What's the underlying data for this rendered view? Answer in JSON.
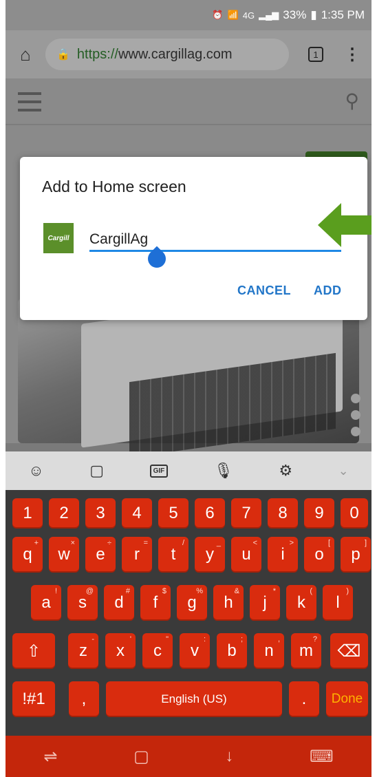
{
  "status_bar": {
    "time": "1:35 PM",
    "battery": "33%",
    "network": "4G",
    "icons": [
      "alarm-icon",
      "wifi-icon",
      "signal-icon",
      "battery-icon"
    ]
  },
  "browser": {
    "url_scheme": "https://",
    "url_host": "www.cargillag.com",
    "tab_count": "1",
    "home_icon": "home-icon",
    "menu_icon": "more-vert-icon"
  },
  "dialog": {
    "title": "Add to Home screen",
    "icon_label": "Cargill",
    "input_value": "CargillAg",
    "cancel_label": "CANCEL",
    "add_label": "ADD"
  },
  "keyboard_toolbar": [
    "emoji-icon",
    "sticker-icon",
    "gif-icon",
    "mic-icon",
    "settings-icon",
    "chevron-down-icon"
  ],
  "keyboard": {
    "row1": [
      "1",
      "2",
      "3",
      "4",
      "5",
      "6",
      "7",
      "8",
      "9",
      "0"
    ],
    "row2": [
      {
        "k": "q",
        "s": "+"
      },
      {
        "k": "w",
        "s": "×"
      },
      {
        "k": "e",
        "s": "÷"
      },
      {
        "k": "r",
        "s": "="
      },
      {
        "k": "t",
        "s": "/"
      },
      {
        "k": "y",
        "s": "_"
      },
      {
        "k": "u",
        "s": "<"
      },
      {
        "k": "i",
        "s": ">"
      },
      {
        "k": "o",
        "s": "["
      },
      {
        "k": "p",
        "s": "]"
      }
    ],
    "row3": [
      {
        "k": "a",
        "s": "!"
      },
      {
        "k": "s",
        "s": "@"
      },
      {
        "k": "d",
        "s": "#"
      },
      {
        "k": "f",
        "s": "$"
      },
      {
        "k": "g",
        "s": "%"
      },
      {
        "k": "h",
        "s": "&"
      },
      {
        "k": "j",
        "s": "*"
      },
      {
        "k": "k",
        "s": "("
      },
      {
        "k": "l",
        "s": ")"
      }
    ],
    "row4": [
      {
        "k": "z",
        "s": "-"
      },
      {
        "k": "x",
        "s": "'"
      },
      {
        "k": "c",
        "s": "\""
      },
      {
        "k": "v",
        "s": ":"
      },
      {
        "k": "b",
        "s": ";"
      },
      {
        "k": "n",
        "s": ","
      },
      {
        "k": "m",
        "s": "?"
      }
    ],
    "symbols_label": "!#1",
    "comma_label": ",",
    "space_label": "English (US)",
    "period_label": ".",
    "done_label": "Done",
    "accent_color": "#d92c0e"
  },
  "nav_bar": [
    "recent-apps-icon",
    "home-button-icon",
    "back-icon",
    "keyboard-icon"
  ]
}
